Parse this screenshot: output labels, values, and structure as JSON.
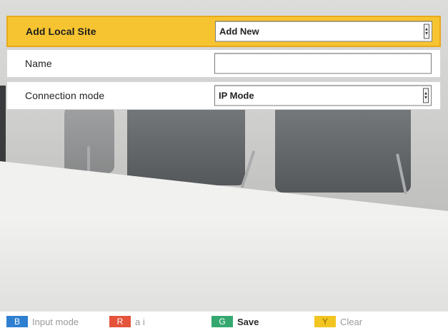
{
  "form": {
    "header": {
      "label": "Add Local Site",
      "select_value": "Add New"
    },
    "name": {
      "label": "Name",
      "value": ""
    },
    "connection_mode": {
      "label": "Connection mode",
      "select_value": "IP Mode"
    }
  },
  "key_bar": [
    {
      "badge": "B",
      "label": "Input mode",
      "color": "#2f7fd1"
    },
    {
      "badge": "R",
      "label": "a i",
      "color": "#e5533b"
    },
    {
      "badge": "G",
      "label": "Save",
      "color": "#35a870"
    },
    {
      "badge": "Y",
      "label": "Clear",
      "color": "#f3c520"
    }
  ],
  "colors": {
    "header_bg": "#f7c431"
  },
  "icons": {
    "dropdown": "dropdown-arrow-icon"
  }
}
